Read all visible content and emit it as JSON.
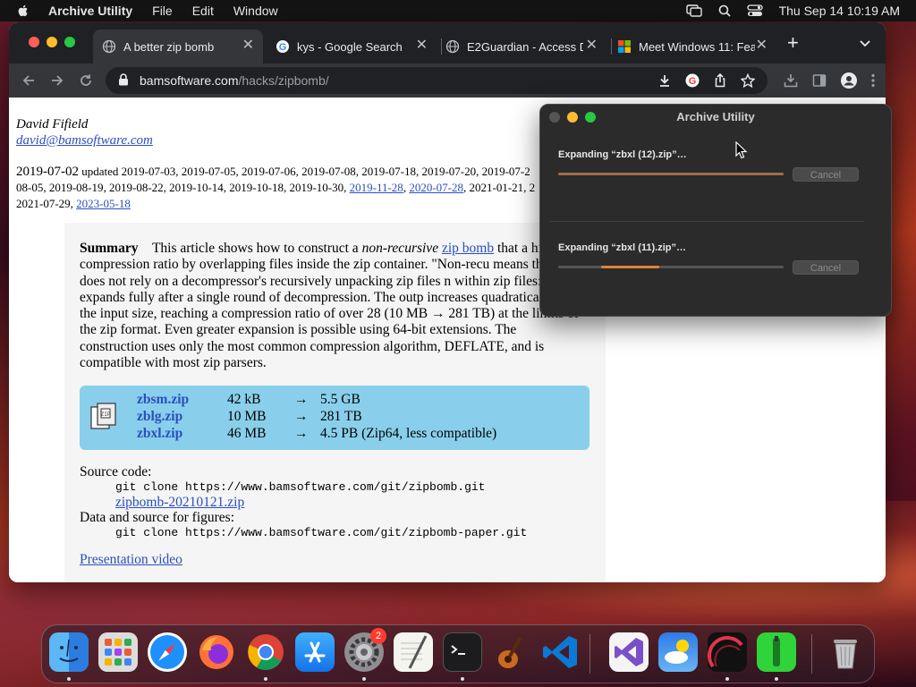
{
  "menubar": {
    "app_name": "Archive Utility",
    "menus": [
      "File",
      "Edit",
      "Window"
    ],
    "datetime": "Thu Sep 14  10:19 AM"
  },
  "browser": {
    "tabs": [
      {
        "title": "A better zip bomb",
        "favicon": "globe-icon",
        "active": true
      },
      {
        "title": "kys - Google Search",
        "favicon": "google-icon",
        "active": false
      },
      {
        "title": "E2Guardian - Access D",
        "favicon": "globe-icon",
        "active": false
      },
      {
        "title": "Meet Windows 11: Fea",
        "favicon": "microsoft-icon",
        "active": false
      }
    ],
    "url_host": "bamsoftware.com",
    "url_path": "/hacks/zipbomb/"
  },
  "page": {
    "author": "David Fifield",
    "email": "david@bamsoftware.com",
    "main_date": "2019-07-02",
    "updated_prefix": " updated 2019-07-03, 2019-07-05, 2019-07-06, 2019-07-08, 2019-07-18, 2019-07-20, 2019-07-2",
    "updated_line2": "08-05, 2019-08-19, 2019-08-22, 2019-10-14, 2019-10-18, 2019-10-30, ",
    "link_date_1": "2019-11-28",
    "link_date_2": "2020-07-28",
    "updated_line2_tail": ", 2021-01-21, 2",
    "updated_line3": "2021-07-29, ",
    "link_date_3": "2023-05-18",
    "summary_heading": "Summary",
    "summary_intro": "This article shows how to construct a ",
    "summary_nonrec": "non-recursive",
    "summary_zipbomb": "zip bomb",
    "summary_rest1": " that",
    "summary_body": "a high compression ratio by overlapping files inside the zip container. \"Non-recu means that it does not rely on a decompressor's recursively unpacking zip files n within zip files: it expands fully after a single round of decompression. The outp increases quadratically in the input size, reaching a compression ratio of over 28 (10 MB → 281 TB) at the limits of the zip format. Even greater expansion is possible using 64-bit extensions. The construction uses only the most common compression algorithm, DEFLATE, and is compatible with most zip parsers.",
    "files": [
      {
        "name": "zbsm.zip",
        "size": "42 kB",
        "arrow": "→",
        "output": "5.5 GB"
      },
      {
        "name": "zblg.zip",
        "size": "10 MB",
        "arrow": "→",
        "output": "281 TB"
      },
      {
        "name": "zbxl.zip",
        "size": "46 MB",
        "arrow": "→",
        "output": "4.5 PB (Zip64, less compatible)"
      }
    ],
    "source_label": "Source code:",
    "git_clone_1": "git clone https://www.bamsoftware.com/git/zipbomb.git",
    "zip_link": "zipbomb-20210121.zip",
    "data_label": "Data and source for figures:",
    "git_clone_2": "git clone https://www.bamsoftware.com/git/zipbomb-paper.git",
    "presentation": "Presentation video"
  },
  "archive_utility": {
    "title": "Archive Utility",
    "items": [
      {
        "label": "Expanding “zbxl (12).zip”…",
        "progress": 1.0,
        "cancel": "Cancel"
      },
      {
        "label": "Expanding “zbxl (11).zip”…",
        "progress_start": 0.19,
        "progress": 0.45,
        "cancel": "Cancel"
      }
    ]
  },
  "dock": {
    "apps": [
      "Finder",
      "Launchpad",
      "Safari",
      "Firefox",
      "Google Chrome",
      "App Store",
      "System Preferences",
      "TextEdit",
      "Terminal",
      "GarageBand",
      "Visual Studio Code",
      "Visual Studio",
      "Weather",
      "Activity Monitor",
      "Green App",
      "Trash"
    ],
    "system_preferences_badge": "2"
  },
  "colors": {
    "accent_progress": "#e0813a",
    "link": "#2a4fbf",
    "files_box": "#89cfeb"
  }
}
